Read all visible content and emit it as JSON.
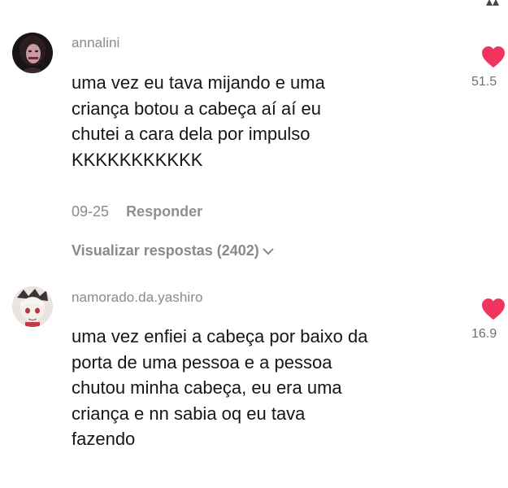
{
  "comments": [
    {
      "username": "annalini",
      "lines": [
        "uma vez eu tava mijando e uma",
        "criança botou a cabeça aí aí eu",
        "chutei a cara dela por impulso",
        "KKKKKKKKKKK"
      ],
      "date": "09-25",
      "reply_label": "Responder",
      "view_replies_label": "Visualizar respostas (2402)",
      "likes": "51.5",
      "avatar_icon": "user-avatar-dark-hair"
    },
    {
      "username": "namorado.da.yashiro",
      "lines": [
        "uma vez enfiei a cabeça por baixo da",
        "porta de uma pessoa e a pessoa",
        "chutou minha cabeça, eu era uma",
        "criança e nn sabia oq eu tava",
        "fazendo"
      ],
      "likes": "16.9",
      "avatar_icon": "user-avatar-anime"
    }
  ],
  "colors": {
    "heart": "#f0345e",
    "muted": "#8a8a8a",
    "text": "#161616"
  }
}
